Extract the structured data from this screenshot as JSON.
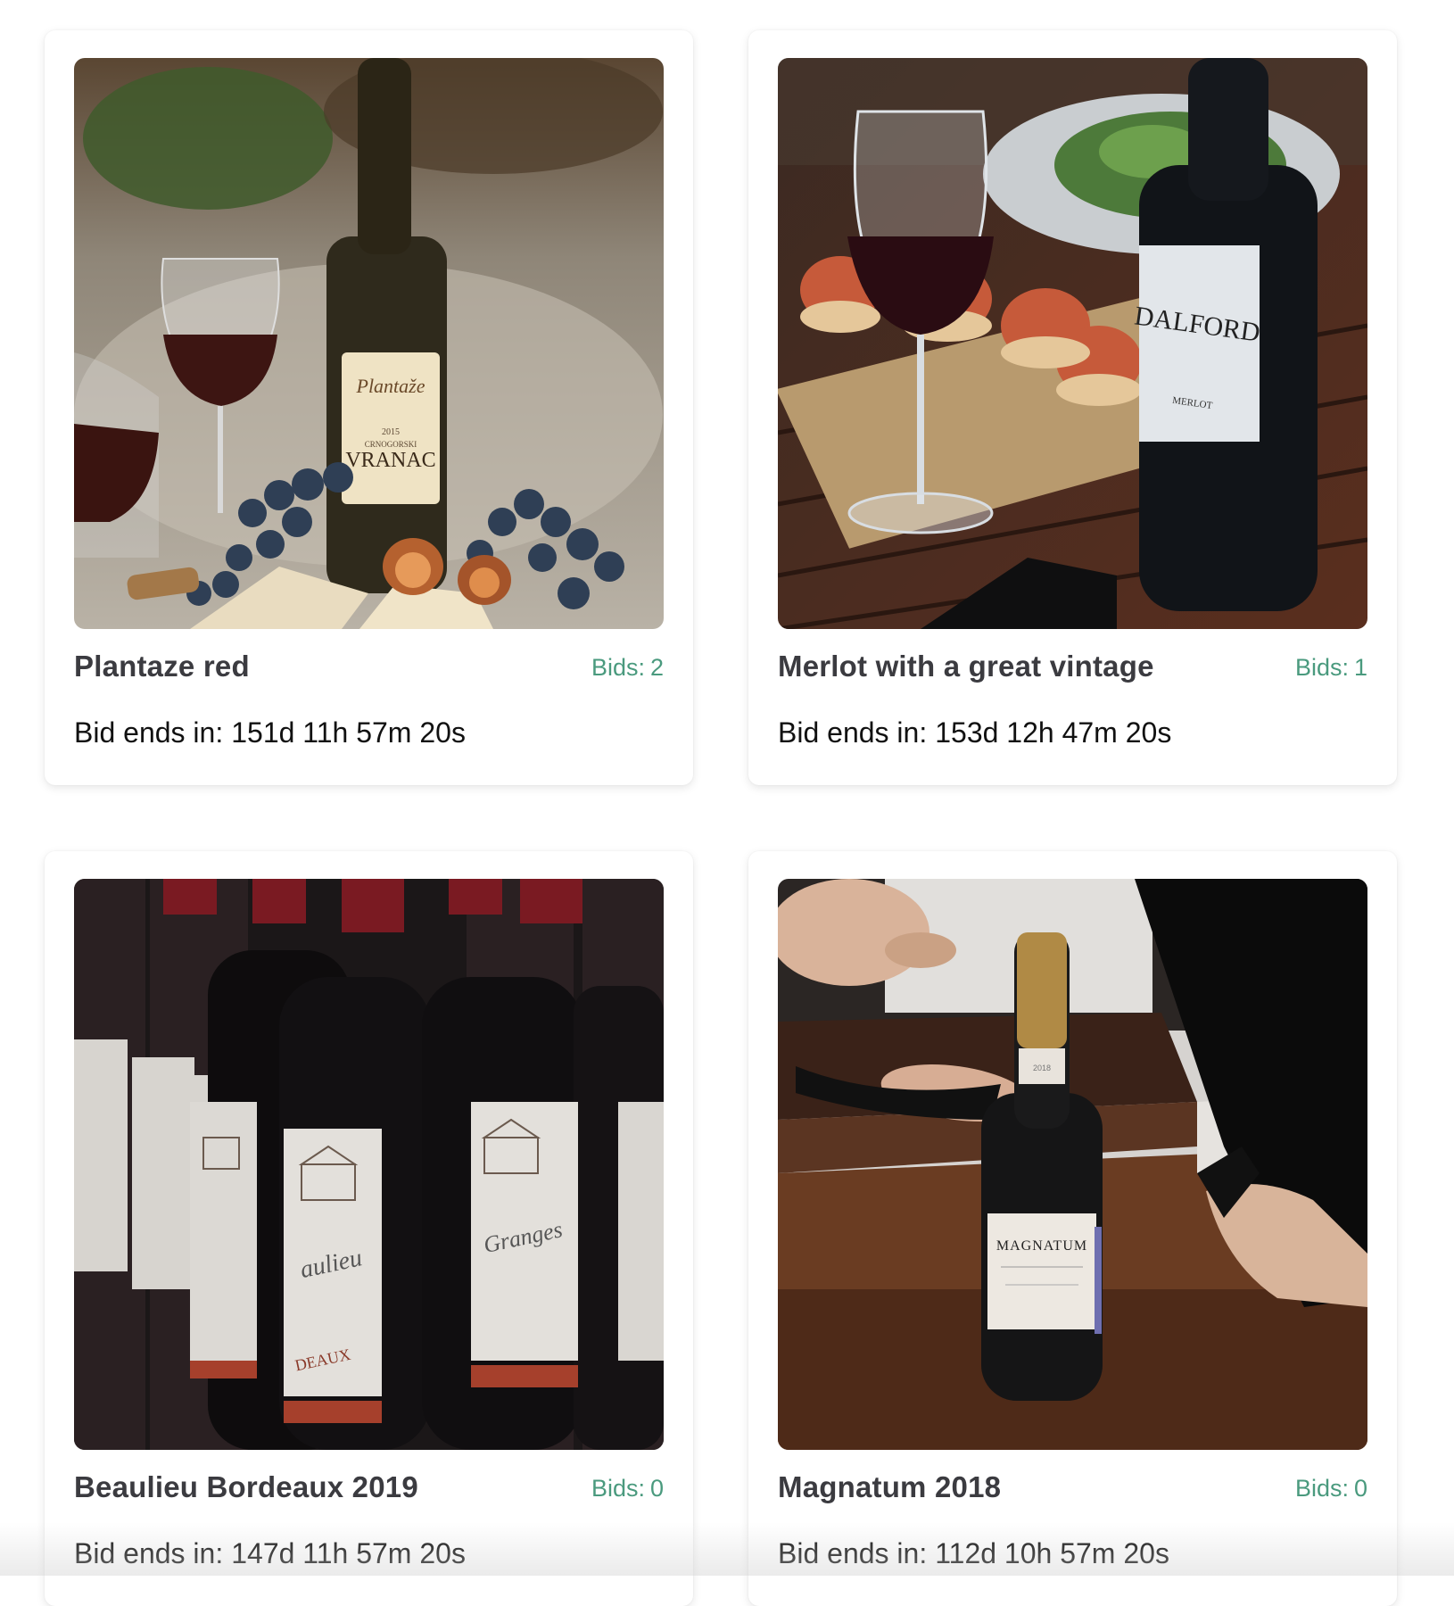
{
  "listings": [
    {
      "title": "Plantaze red",
      "bids_label": "Bids:",
      "bids_count": "2",
      "ends_label": "Bid ends in:",
      "ends_value": "151d 11h 57m 20s",
      "image_labels": [
        "Plantaže",
        "2015",
        "CRNOGORSKI",
        "VRANAC"
      ]
    },
    {
      "title": "Merlot with a great vintage",
      "bids_label": "Bids:",
      "bids_count": "1",
      "ends_label": "Bid ends in:",
      "ends_value": "153d 12h 47m 20s",
      "image_labels": [
        "DALFORD",
        "MERLOT"
      ]
    },
    {
      "title": "Beaulieu Bordeaux 2019",
      "bids_label": "Bids:",
      "bids_count": "0",
      "ends_label": "Bid ends in:",
      "ends_value": "147d 11h 57m 20s",
      "image_labels": [
        "Granges",
        "aulieu",
        "DEAUX"
      ]
    },
    {
      "title": "Magnatum 2018",
      "bids_label": "Bids:",
      "bids_count": "0",
      "ends_label": "Bid ends in:",
      "ends_value": "112d 10h 57m 20s",
      "image_labels": [
        "2018",
        "MAGNATUM"
      ]
    }
  ],
  "colors": {
    "title": "#3b3b40",
    "bids": "#4a9a7e",
    "text": "#111111"
  }
}
